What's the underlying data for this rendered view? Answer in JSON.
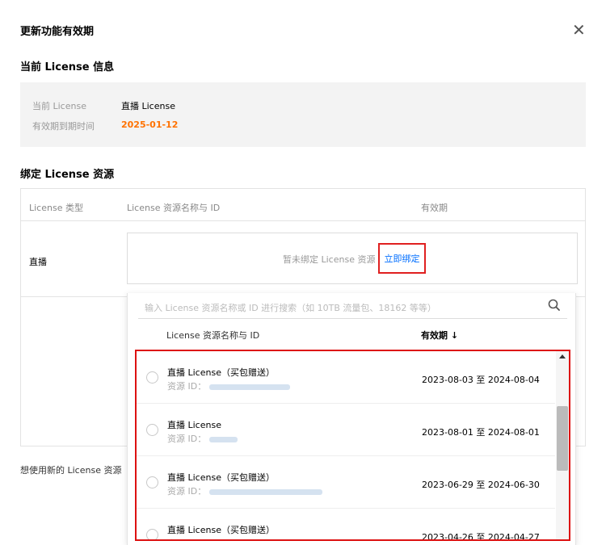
{
  "dialog": {
    "title": "更新功能有效期",
    "close_icon": "close-icon"
  },
  "current_license": {
    "section_title": "当前 License 信息",
    "license_label": "当前 License",
    "license_value": "直播 License",
    "expiry_label": "有效期到期时间",
    "expiry_value": "2025-01-12",
    "expiry_color": "#ff7200"
  },
  "bind": {
    "section_title": "绑定 License 资源",
    "table": {
      "headers": [
        "License 类型",
        "License 资源名称与 ID",
        "有效期"
      ],
      "row_type": "直播",
      "unbound_text": "暂未绑定 License 资源",
      "bind_now": "立即绑定"
    },
    "bottom_text": "想使用新的 License 资源"
  },
  "dropdown": {
    "search_placeholder": "输入 License 资源名称或 ID 进行搜索（如 10TB 流量包、18162 等等）",
    "col_name": "License 资源名称与 ID",
    "col_validity": "有效期 ↓",
    "id_prefix": "资源 ID：",
    "items": [
      {
        "name": "直播 License（买包赠送）",
        "date": "2023-08-03 至 2024-08-04"
      },
      {
        "name": "直播 License",
        "date": "2023-08-01 至 2024-08-01"
      },
      {
        "name": "直播 License（买包赠送）",
        "date": "2023-06-29 至 2024-06-30"
      },
      {
        "name": "直播 License（买包赠送）",
        "date": "2023-04-26 至 2024-04-27"
      }
    ]
  },
  "colors": {
    "accent": "#006eff",
    "highlight_border": "#e02020"
  }
}
